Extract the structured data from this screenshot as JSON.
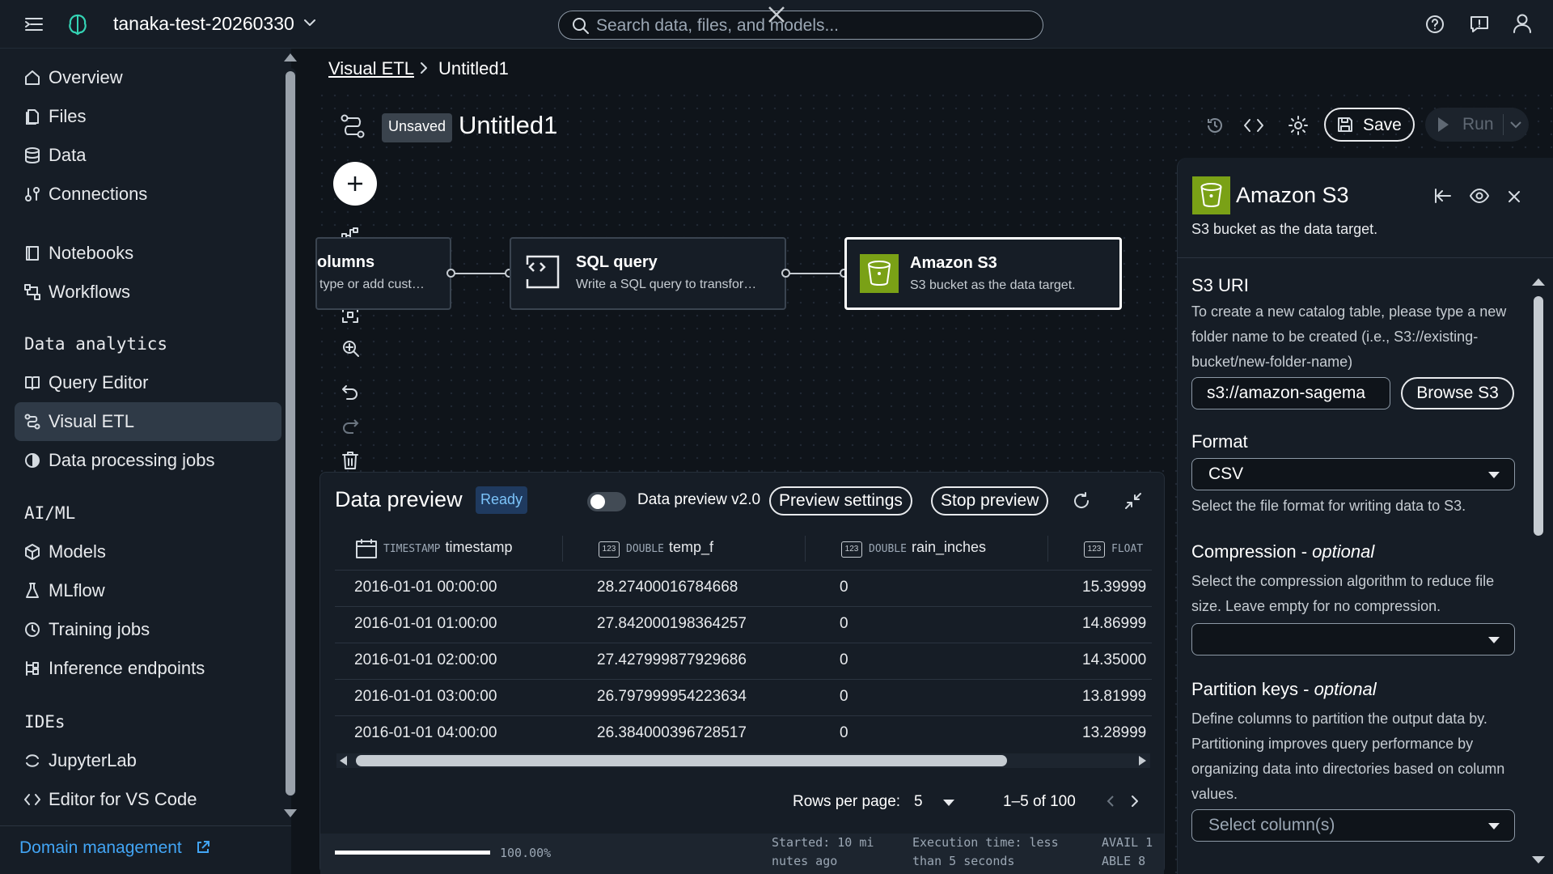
{
  "topbar": {
    "project": "tanaka-test-20260330",
    "search_placeholder": "Search data, files, and models..."
  },
  "sidebar": {
    "items_main": [
      {
        "label": "Overview",
        "icon": "home-icon"
      },
      {
        "label": "Files",
        "icon": "file-icon"
      },
      {
        "label": "Data",
        "icon": "database-icon"
      },
      {
        "label": "Connections",
        "icon": "connections-icon"
      }
    ],
    "items_tools": [
      {
        "label": "Notebooks",
        "icon": "notebook-icon"
      },
      {
        "label": "Workflows",
        "icon": "workflow-icon"
      }
    ],
    "section_analytics": "Data analytics",
    "items_analytics": [
      {
        "label": "Query Editor",
        "icon": "book-icon"
      },
      {
        "label": "Visual ETL",
        "icon": "etl-icon"
      },
      {
        "label": "Data processing jobs",
        "icon": "pie-icon"
      }
    ],
    "section_aiml": "AI/ML",
    "items_aiml": [
      {
        "label": "Models",
        "icon": "cube-icon"
      },
      {
        "label": "MLflow",
        "icon": "flask-icon"
      },
      {
        "label": "Training jobs",
        "icon": "clock-icon"
      },
      {
        "label": "Inference endpoints",
        "icon": "endpoint-icon"
      }
    ],
    "section_ides": "IDEs",
    "items_ides": [
      {
        "label": "JupyterLab",
        "icon": "jupyter-icon"
      },
      {
        "label": "Editor for VS Code",
        "icon": "code-icon"
      }
    ],
    "domain_management": "Domain management"
  },
  "breadcrumb": {
    "parent": "Visual ETL",
    "current": "Untitled1"
  },
  "editor": {
    "badge": "Unsaved",
    "title": "Untitled1",
    "save_label": "Save",
    "run_label": "Run"
  },
  "nodes": [
    {
      "title": "olumns",
      "desc": "type or add cust…"
    },
    {
      "title": "SQL query",
      "desc": "Write a SQL query to transfor…"
    },
    {
      "title": "Amazon S3",
      "desc": "S3 bucket as the data target."
    }
  ],
  "preview": {
    "title": "Data preview",
    "status": "Ready",
    "toggle_label": "Data preview v2.0",
    "settings_label": "Preview settings",
    "stop_label": "Stop preview",
    "columns": [
      {
        "type": "TIMESTAMP",
        "name": "timestamp"
      },
      {
        "type": "DOUBLE",
        "name": "temp_f"
      },
      {
        "type": "DOUBLE",
        "name": "rain_inches"
      },
      {
        "type": "FLOAT",
        "name": ""
      }
    ],
    "rows": [
      [
        "2016-01-01 00:00:00",
        "28.27400016784668",
        "0",
        "15.39999"
      ],
      [
        "2016-01-01 01:00:00",
        "27.842000198364257",
        "0",
        "14.86999"
      ],
      [
        "2016-01-01 02:00:00",
        "27.427999877929686",
        "0",
        "14.35000"
      ],
      [
        "2016-01-01 03:00:00",
        "26.797999954223634",
        "0",
        "13.81999"
      ],
      [
        "2016-01-01 04:00:00",
        "26.384000396728517",
        "0",
        "13.28999"
      ]
    ],
    "rows_per_page_label": "Rows per page:",
    "rows_per_page": "5",
    "range": "1–5 of 100",
    "progress_label": "100.00%",
    "progress": 1.0,
    "started": "Started: 10 mi\nnutes ago",
    "execution": "Execution time: less\nthan 5 seconds",
    "avail": "AVAIL 1\nABLE 8"
  },
  "panel": {
    "title": "Amazon S3",
    "subtitle": "S3 bucket as the data target.",
    "s3uri_heading": "S3 URI",
    "s3uri_desc": "To create a new catalog table, please type a new folder name to be created (i.e., S3://existing-bucket/new-folder-name)",
    "s3uri_value": "s3://amazon-sagema",
    "browse_label": "Browse S3",
    "format_heading": "Format",
    "format_value": "CSV",
    "format_desc": "Select the file format for writing data to S3.",
    "compression_heading": "Compression - ",
    "compression_optional": "optional",
    "compression_desc": "Select the compression algorithm to reduce file size. Leave empty for no compression.",
    "partition_heading": "Partition keys - ",
    "partition_optional": "optional",
    "partition_desc": "Define columns to partition the output data by. Partitioning improves query performance by organizing data into directories based on column values.",
    "partition_placeholder": "Select column(s)"
  },
  "colors": {
    "bucket_green": "#7aa116",
    "ready_badge": "#1f3a5f",
    "active_nav": "#2f3a47"
  }
}
